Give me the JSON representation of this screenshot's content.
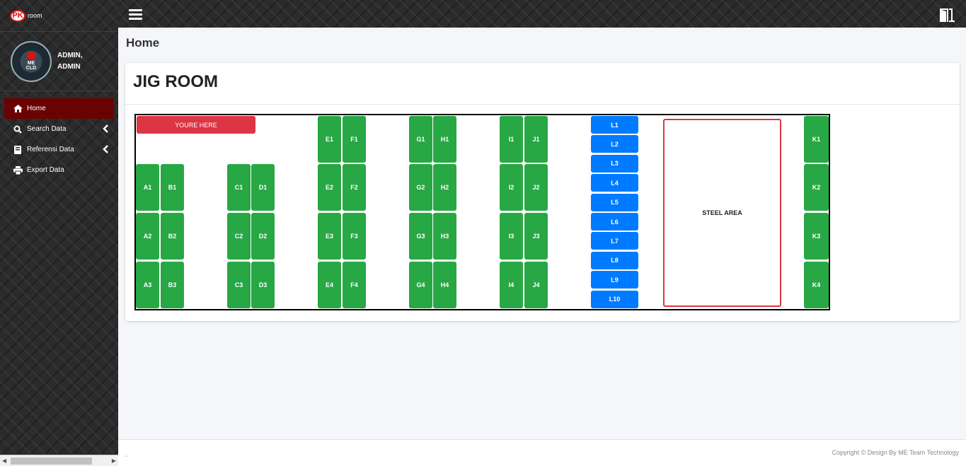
{
  "brand": {
    "logo_text": "PK",
    "text": "room"
  },
  "user": {
    "name_line1": "ADMIN,",
    "name_line2": "ADMIN",
    "avatar_text_1": "ME",
    "avatar_text_2": "CLD"
  },
  "sidebar": {
    "items": [
      {
        "label": "Home",
        "icon": "home-icon",
        "active": true
      },
      {
        "label": "Search Data",
        "icon": "search-icon",
        "has_arrow": true
      },
      {
        "label": "Referensi Data",
        "icon": "book-icon",
        "has_arrow": true
      },
      {
        "label": "Export Data",
        "icon": "print-icon"
      }
    ]
  },
  "page": {
    "title": "Home"
  },
  "card": {
    "title": "JIG ROOM"
  },
  "room": {
    "you_here": "YOURE HERE",
    "steel_area": "STEEL AREA",
    "green_slots": [
      "A1",
      "B1",
      "A2",
      "B2",
      "A3",
      "B3",
      "C1",
      "D1",
      "C2",
      "D2",
      "C3",
      "D3",
      "E1",
      "F1",
      "E2",
      "F2",
      "E3",
      "F3",
      "E4",
      "F4",
      "G1",
      "H1",
      "G2",
      "H2",
      "G3",
      "H3",
      "G4",
      "H4",
      "I1",
      "J1",
      "I2",
      "J2",
      "I3",
      "J3",
      "I4",
      "J4",
      "K1",
      "K2",
      "K3",
      "K4"
    ],
    "blue_slots": [
      "L1",
      "L2",
      "L3",
      "L4",
      "L5",
      "L6",
      "L7",
      "L8",
      "L9",
      "L10"
    ]
  },
  "footer": {
    "left": "-",
    "right": "Copyright © Design By ME Team Technology"
  },
  "colors": {
    "green": "#28a745",
    "blue": "#007bff",
    "red": "#dc3545",
    "active_menu": "#6b0202"
  }
}
